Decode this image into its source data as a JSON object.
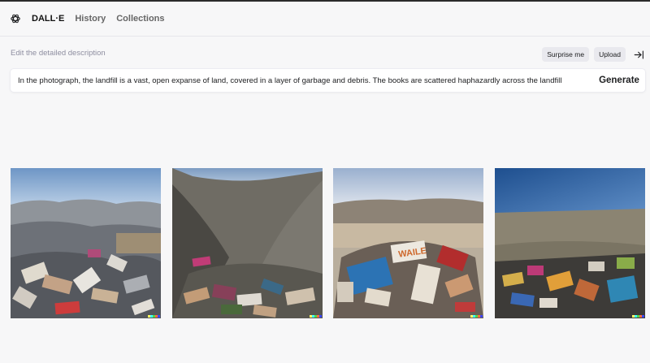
{
  "nav": {
    "logo_icon": "openai-logo-icon",
    "brand": "DALL·E",
    "history": "History",
    "collections": "Collections"
  },
  "editor": {
    "label": "Edit the detailed description",
    "surprise_label": "Surprise me",
    "upload_label": "Upload",
    "collapse_icon": "arrow-right-to-bar-icon",
    "prompt_value": "In the photograph, the landfill is a vast, open expanse of land, covered in a layer of garbage and debris. The books are scattered haphazardly across the landfill",
    "generate_label": "Generate"
  },
  "results": {
    "images": [
      {
        "subject": "landfill-books-1"
      },
      {
        "subject": "landfill-books-2"
      },
      {
        "subject": "landfill-books-3"
      },
      {
        "subject": "landfill-books-4"
      }
    ],
    "watermark_colors": [
      "#ffff66",
      "#42ffff",
      "#51da4c",
      "#ff6e3c",
      "#3c46ff"
    ]
  }
}
